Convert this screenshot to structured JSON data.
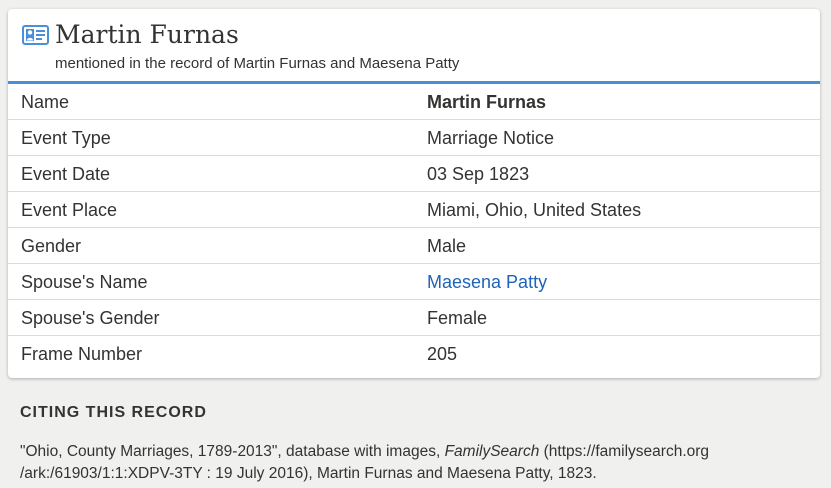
{
  "header": {
    "icon": "person-card-icon",
    "name": "Martin Furnas",
    "subtitle": "mentioned in the record of Martin Furnas and Maesena Patty"
  },
  "fields": [
    {
      "label": "Name",
      "value": "Martin Furnas"
    },
    {
      "label": "Event Type",
      "value": "Marriage Notice"
    },
    {
      "label": "Event Date",
      "value": "03 Sep 1823"
    },
    {
      "label": "Event Place",
      "value": "Miami, Ohio, United States"
    },
    {
      "label": "Gender",
      "value": "Male"
    },
    {
      "label": "Spouse's Name",
      "value": "Maesena Patty"
    },
    {
      "label": "Spouse's Gender",
      "value": "Female"
    },
    {
      "label": "Frame Number",
      "value": "205"
    }
  ],
  "citing": {
    "title": "CITING THIS RECORD",
    "text_before": "\"Ohio, County Marriages, 1789-2013\", database with images, ",
    "text_italic": "FamilySearch",
    "text_line1_after": " (https://familysearch.org",
    "text_line2": "/ark:/61903/1:1:XDPV-3TY : 19 July 2016), Martin Furnas and Maesena Patty, 1823."
  },
  "colors": {
    "accent": "#4a90d9",
    "link": "#1e63b8",
    "background": "#f0f0ef"
  }
}
